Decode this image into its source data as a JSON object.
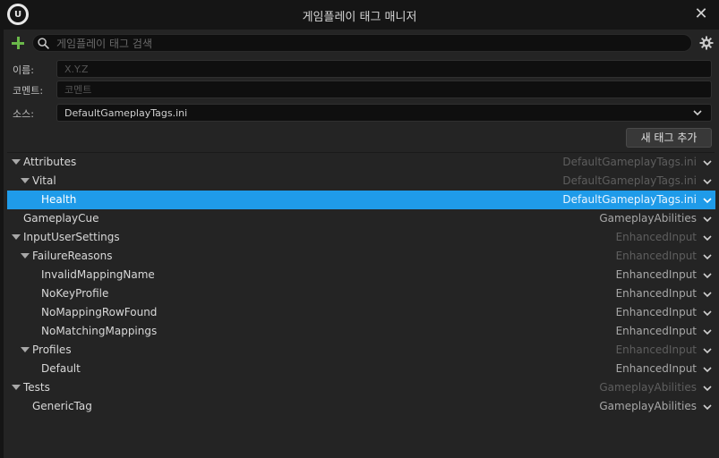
{
  "window": {
    "title": "게임플레이 태그 매니저",
    "logo_text": "U"
  },
  "toolbar": {
    "search_placeholder": "게임플레이 태그 검색"
  },
  "form": {
    "name_label": "이름:",
    "name_placeholder": "X.Y.Z",
    "comment_label": "코멘트:",
    "comment_placeholder": "코멘트",
    "source_label": "소스:",
    "source_value": "DefaultGameplayTags.ini",
    "add_button_label": "새 태그 추가"
  },
  "tree": {
    "rows": [
      {
        "label": "Attributes",
        "source": "DefaultGameplayTags.ini",
        "expanded": true,
        "selected": false
      },
      {
        "label": "Vital",
        "source": "DefaultGameplayTags.ini",
        "expanded": true,
        "selected": false
      },
      {
        "label": "Health",
        "source": "DefaultGameplayTags.ini",
        "expanded": false,
        "selected": true
      },
      {
        "label": "GameplayCue",
        "source": "GameplayAbilities",
        "expanded": false,
        "selected": false
      },
      {
        "label": "InputUserSettings",
        "source": "EnhancedInput",
        "expanded": true,
        "selected": false
      },
      {
        "label": "FailureReasons",
        "source": "EnhancedInput",
        "expanded": true,
        "selected": false
      },
      {
        "label": "InvalidMappingName",
        "source": "EnhancedInput",
        "expanded": false,
        "selected": false
      },
      {
        "label": "NoKeyProfile",
        "source": "EnhancedInput",
        "expanded": false,
        "selected": false
      },
      {
        "label": "NoMappingRowFound",
        "source": "EnhancedInput",
        "expanded": false,
        "selected": false
      },
      {
        "label": "NoMatchingMappings",
        "source": "EnhancedInput",
        "expanded": false,
        "selected": false
      },
      {
        "label": "Profiles",
        "source": "EnhancedInput",
        "expanded": true,
        "selected": false
      },
      {
        "label": "Default",
        "source": "EnhancedInput",
        "expanded": false,
        "selected": false
      },
      {
        "label": "Tests",
        "source": "GameplayAbilities",
        "expanded": true,
        "selected": false
      },
      {
        "label": "GenericTag",
        "source": "GameplayAbilities",
        "expanded": false,
        "selected": false
      }
    ]
  },
  "colors": {
    "accent": "#1f9be9",
    "add": "#6ab84a",
    "background": "#242424"
  },
  "icons": [
    "add-icon",
    "search-icon",
    "gear-icon",
    "close-icon",
    "chevron-down-icon",
    "expand-arrow-icon"
  ]
}
